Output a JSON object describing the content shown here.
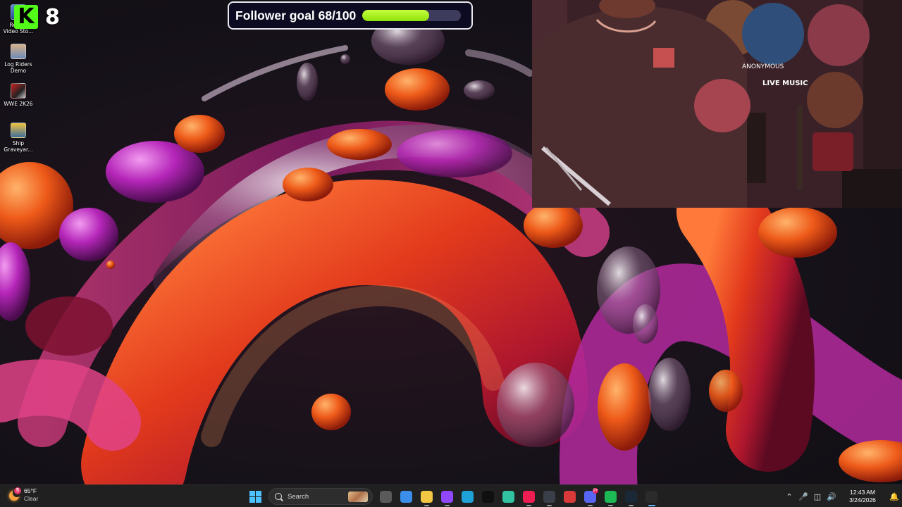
{
  "desktop_icons": [
    {
      "label": "Retro - Video Sto...",
      "icon": "retro-video-store-icon"
    },
    {
      "label": "Log Riders Demo",
      "icon": "log-riders-icon"
    },
    {
      "label": "WWE 2K26",
      "icon": "wwe-2k26-icon"
    },
    {
      "label": "Ship Graveyar...",
      "icon": "ship-graveyard-icon"
    }
  ],
  "kick": {
    "logo": "K",
    "count": "8",
    "brand_color": "#53fc18"
  },
  "follower_goal": {
    "label": "Follower goal 68/100",
    "current": 68,
    "target": 100,
    "progress": 0.68,
    "fill_color": "#b2f31a"
  },
  "webcam": {
    "sign_text": "LIVE MUSIC",
    "poster_text": "ANONYMOUS"
  },
  "taskbar": {
    "weather": {
      "temp": "65°F",
      "condition": "Clear",
      "badge": "5"
    },
    "search_placeholder": "Search",
    "pinned_apps": [
      {
        "name": "task-view-icon",
        "color": "#5a5a5a"
      },
      {
        "name": "microsoft-store-icon",
        "color": "#3b8eea"
      },
      {
        "name": "file-explorer-icon",
        "color": "#f2c744"
      },
      {
        "name": "twitch-icon",
        "color": "#9146ff"
      },
      {
        "name": "edge-icon",
        "color": "#1fa2d8"
      },
      {
        "name": "tiktok-studio-icon",
        "color": "#101010"
      },
      {
        "name": "streamlabs-icon",
        "color": "#31c3a2"
      },
      {
        "name": "tiktok-icon",
        "color": "#ee1d52"
      },
      {
        "name": "streamer-bot-icon",
        "color": "#3a3f4a"
      },
      {
        "name": "gamesir-icon",
        "color": "#d83a3a"
      },
      {
        "name": "discord-icon",
        "color": "#5865f2"
      },
      {
        "name": "spotify-icon",
        "color": "#1db954"
      },
      {
        "name": "steam-icon",
        "color": "#1b2838"
      },
      {
        "name": "obs-icon",
        "color": "#2b2b2b"
      }
    ],
    "discord_badge": "9+",
    "clock": {
      "time": "12:43 AM",
      "date": "3/24/2026"
    }
  }
}
